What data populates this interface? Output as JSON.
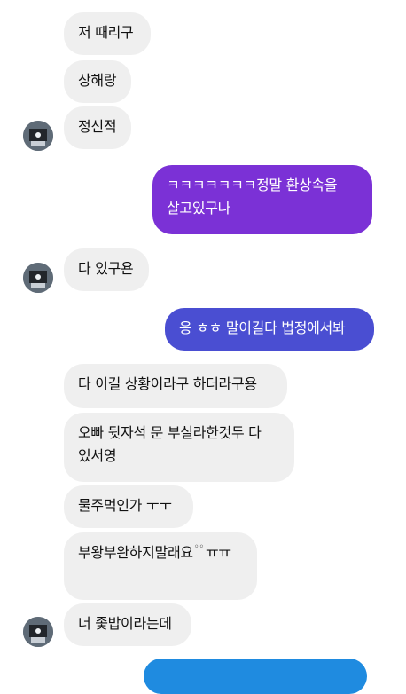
{
  "colors": {
    "incoming_bg": "#efefef",
    "incoming_text": "#111111",
    "outgoing_purple": "#7b31d6",
    "outgoing_indigo": "#4a4ed2",
    "outgoing_blue": "#1f8be0"
  },
  "messages": [
    {
      "dir": "in",
      "text": "저 때리구"
    },
    {
      "dir": "in",
      "text": "상해랑"
    },
    {
      "dir": "in",
      "text": "정신적",
      "avatar": "avatar-icon"
    },
    {
      "dir": "out",
      "text": "ㅋㅋㅋㅋㅋㅋㅋ정말 환상속을 살고있구나"
    },
    {
      "dir": "in",
      "text": "다 있구욘",
      "avatar": "avatar-icon"
    },
    {
      "dir": "out",
      "text": "응 ㅎㅎ 말이길다 법정에서봐"
    },
    {
      "dir": "in",
      "text": "다 이길 상황이라구 하더라구용"
    },
    {
      "dir": "in",
      "text": "오빠 뒷자석 문 부실라한것두 다 있서영"
    },
    {
      "dir": "in",
      "text": "물주먹인가 ㅜㅜ"
    },
    {
      "dir": "in",
      "text": "부왕부완하지말래요"
    },
    {
      "dir": "in",
      "text": "너 좇밥이라는데",
      "avatar": "avatar-icon"
    }
  ],
  "emoji_suffix": "ㅠㅠ"
}
